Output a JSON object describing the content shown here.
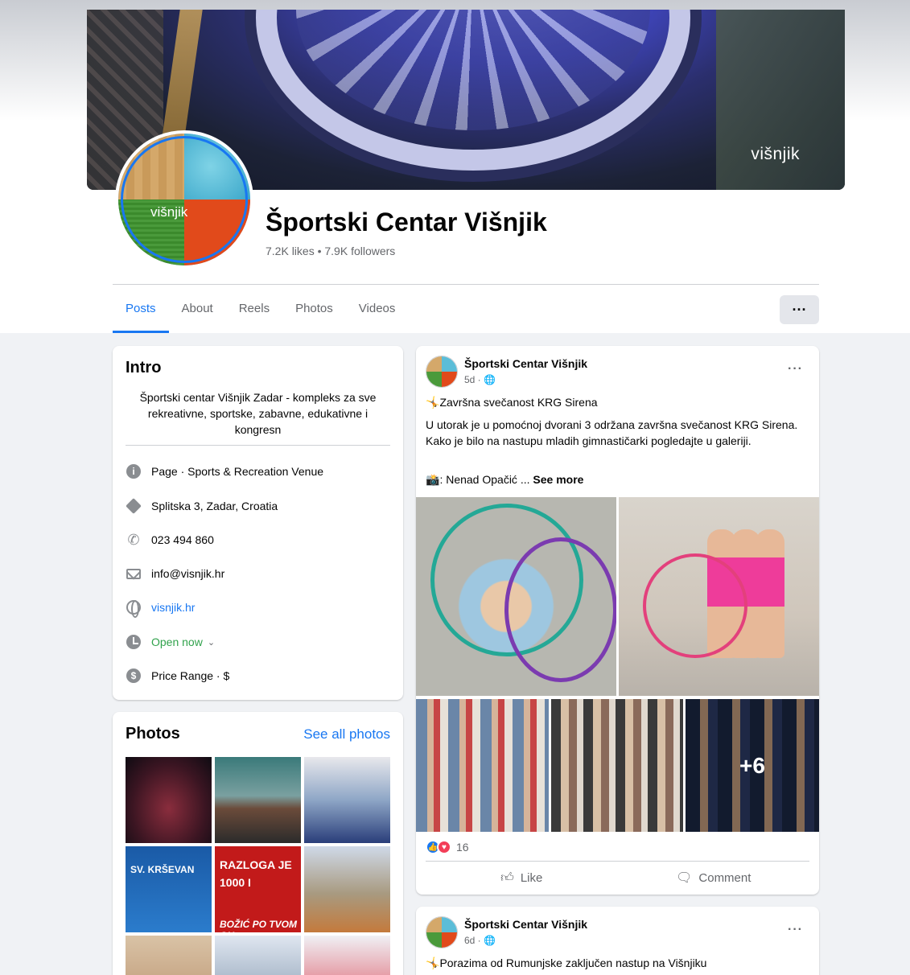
{
  "page": {
    "name": "Športski Centar Višnjik",
    "stats": "7.2K likes • 7.9K followers",
    "logo_text": "višnjik"
  },
  "tabs": [
    {
      "label": "Posts",
      "active": true
    },
    {
      "label": "About"
    },
    {
      "label": "Reels"
    },
    {
      "label": "Photos"
    },
    {
      "label": "Videos"
    }
  ],
  "more_button": "···",
  "intro": {
    "title": "Intro",
    "bio": "Športski centar Višnjik Zadar - kompleks za sve rekreativne, sportske, zabavne, edukativne i kongresn",
    "rows": [
      {
        "icon": "info-icon",
        "text": "Page · Sports & Recreation Venue"
      },
      {
        "icon": "location-icon",
        "text": "Splitska 3, Zadar, Croatia"
      },
      {
        "icon": "phone-icon",
        "text": "023 494 860"
      },
      {
        "icon": "mail-icon",
        "text": "info@visnjik.hr"
      },
      {
        "icon": "globe-icon",
        "text": "visnjik.hr"
      },
      {
        "icon": "clock-icon",
        "text": "Open now"
      },
      {
        "icon": "price-icon",
        "text": "Price Range · $"
      }
    ]
  },
  "photos": {
    "title": "Photos",
    "see_all": "See all photos",
    "thumb_captions": [
      "SV. KRŠEVAN",
      "RAZLOGA JE 1000 I",
      "BOŽIĆ PO TVOM GU"
    ]
  },
  "posts": [
    {
      "author": "Športski Centar Višnjik",
      "time": "5d · 🌐",
      "headline": "Završna svečanost KRG Sirena",
      "body": "U utorak je u pomoćnoj dvorani 3 održana završna svečanost KRG Sirena. Kako je bilo na nastupu mladih gimnastičarki pogledajte u galeriji.",
      "credit": ": Nenad Opačić ... ",
      "see_more": "See more",
      "more_photos": "+6",
      "reaction_count": "16",
      "like_label": "Like",
      "comment_label": "Comment"
    },
    {
      "author": "Športski Centar Višnjik",
      "time": "6d · 🌐",
      "headline": "Porazima od Rumunjske zaključen nastup na Višnjiku"
    }
  ],
  "colors": {
    "accent": "#1877f2",
    "open": "#31a24c",
    "background": "#f0f2f5"
  }
}
